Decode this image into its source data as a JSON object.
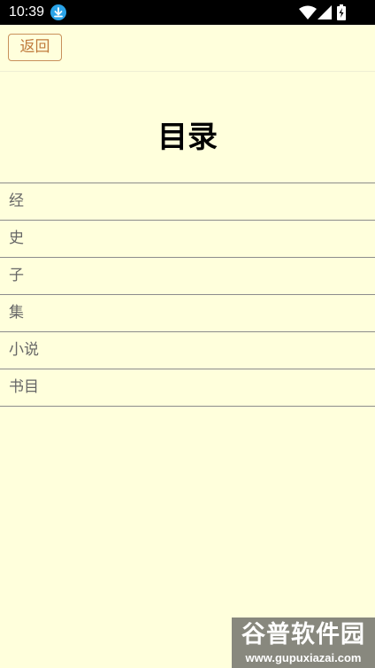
{
  "status_bar": {
    "time": "10:39",
    "icons": [
      "download-icon",
      "wifi-icon",
      "signal-icon",
      "battery-icon"
    ]
  },
  "toolbar": {
    "back_label": "返回"
  },
  "page": {
    "title": "目录"
  },
  "toc": {
    "items": [
      {
        "label": "经"
      },
      {
        "label": "史"
      },
      {
        "label": "子"
      },
      {
        "label": "集"
      },
      {
        "label": "小说"
      },
      {
        "label": "书目"
      }
    ]
  },
  "watermark": {
    "title": "谷普软件园",
    "url": "www.gupuxiazai.com"
  },
  "colors": {
    "background": "#ffffdc",
    "status_bar": "#000000",
    "accent": "#c07a3c",
    "divider": "#8c8c8c",
    "item_text": "#666666",
    "download_badge": "#2aa3e8"
  }
}
